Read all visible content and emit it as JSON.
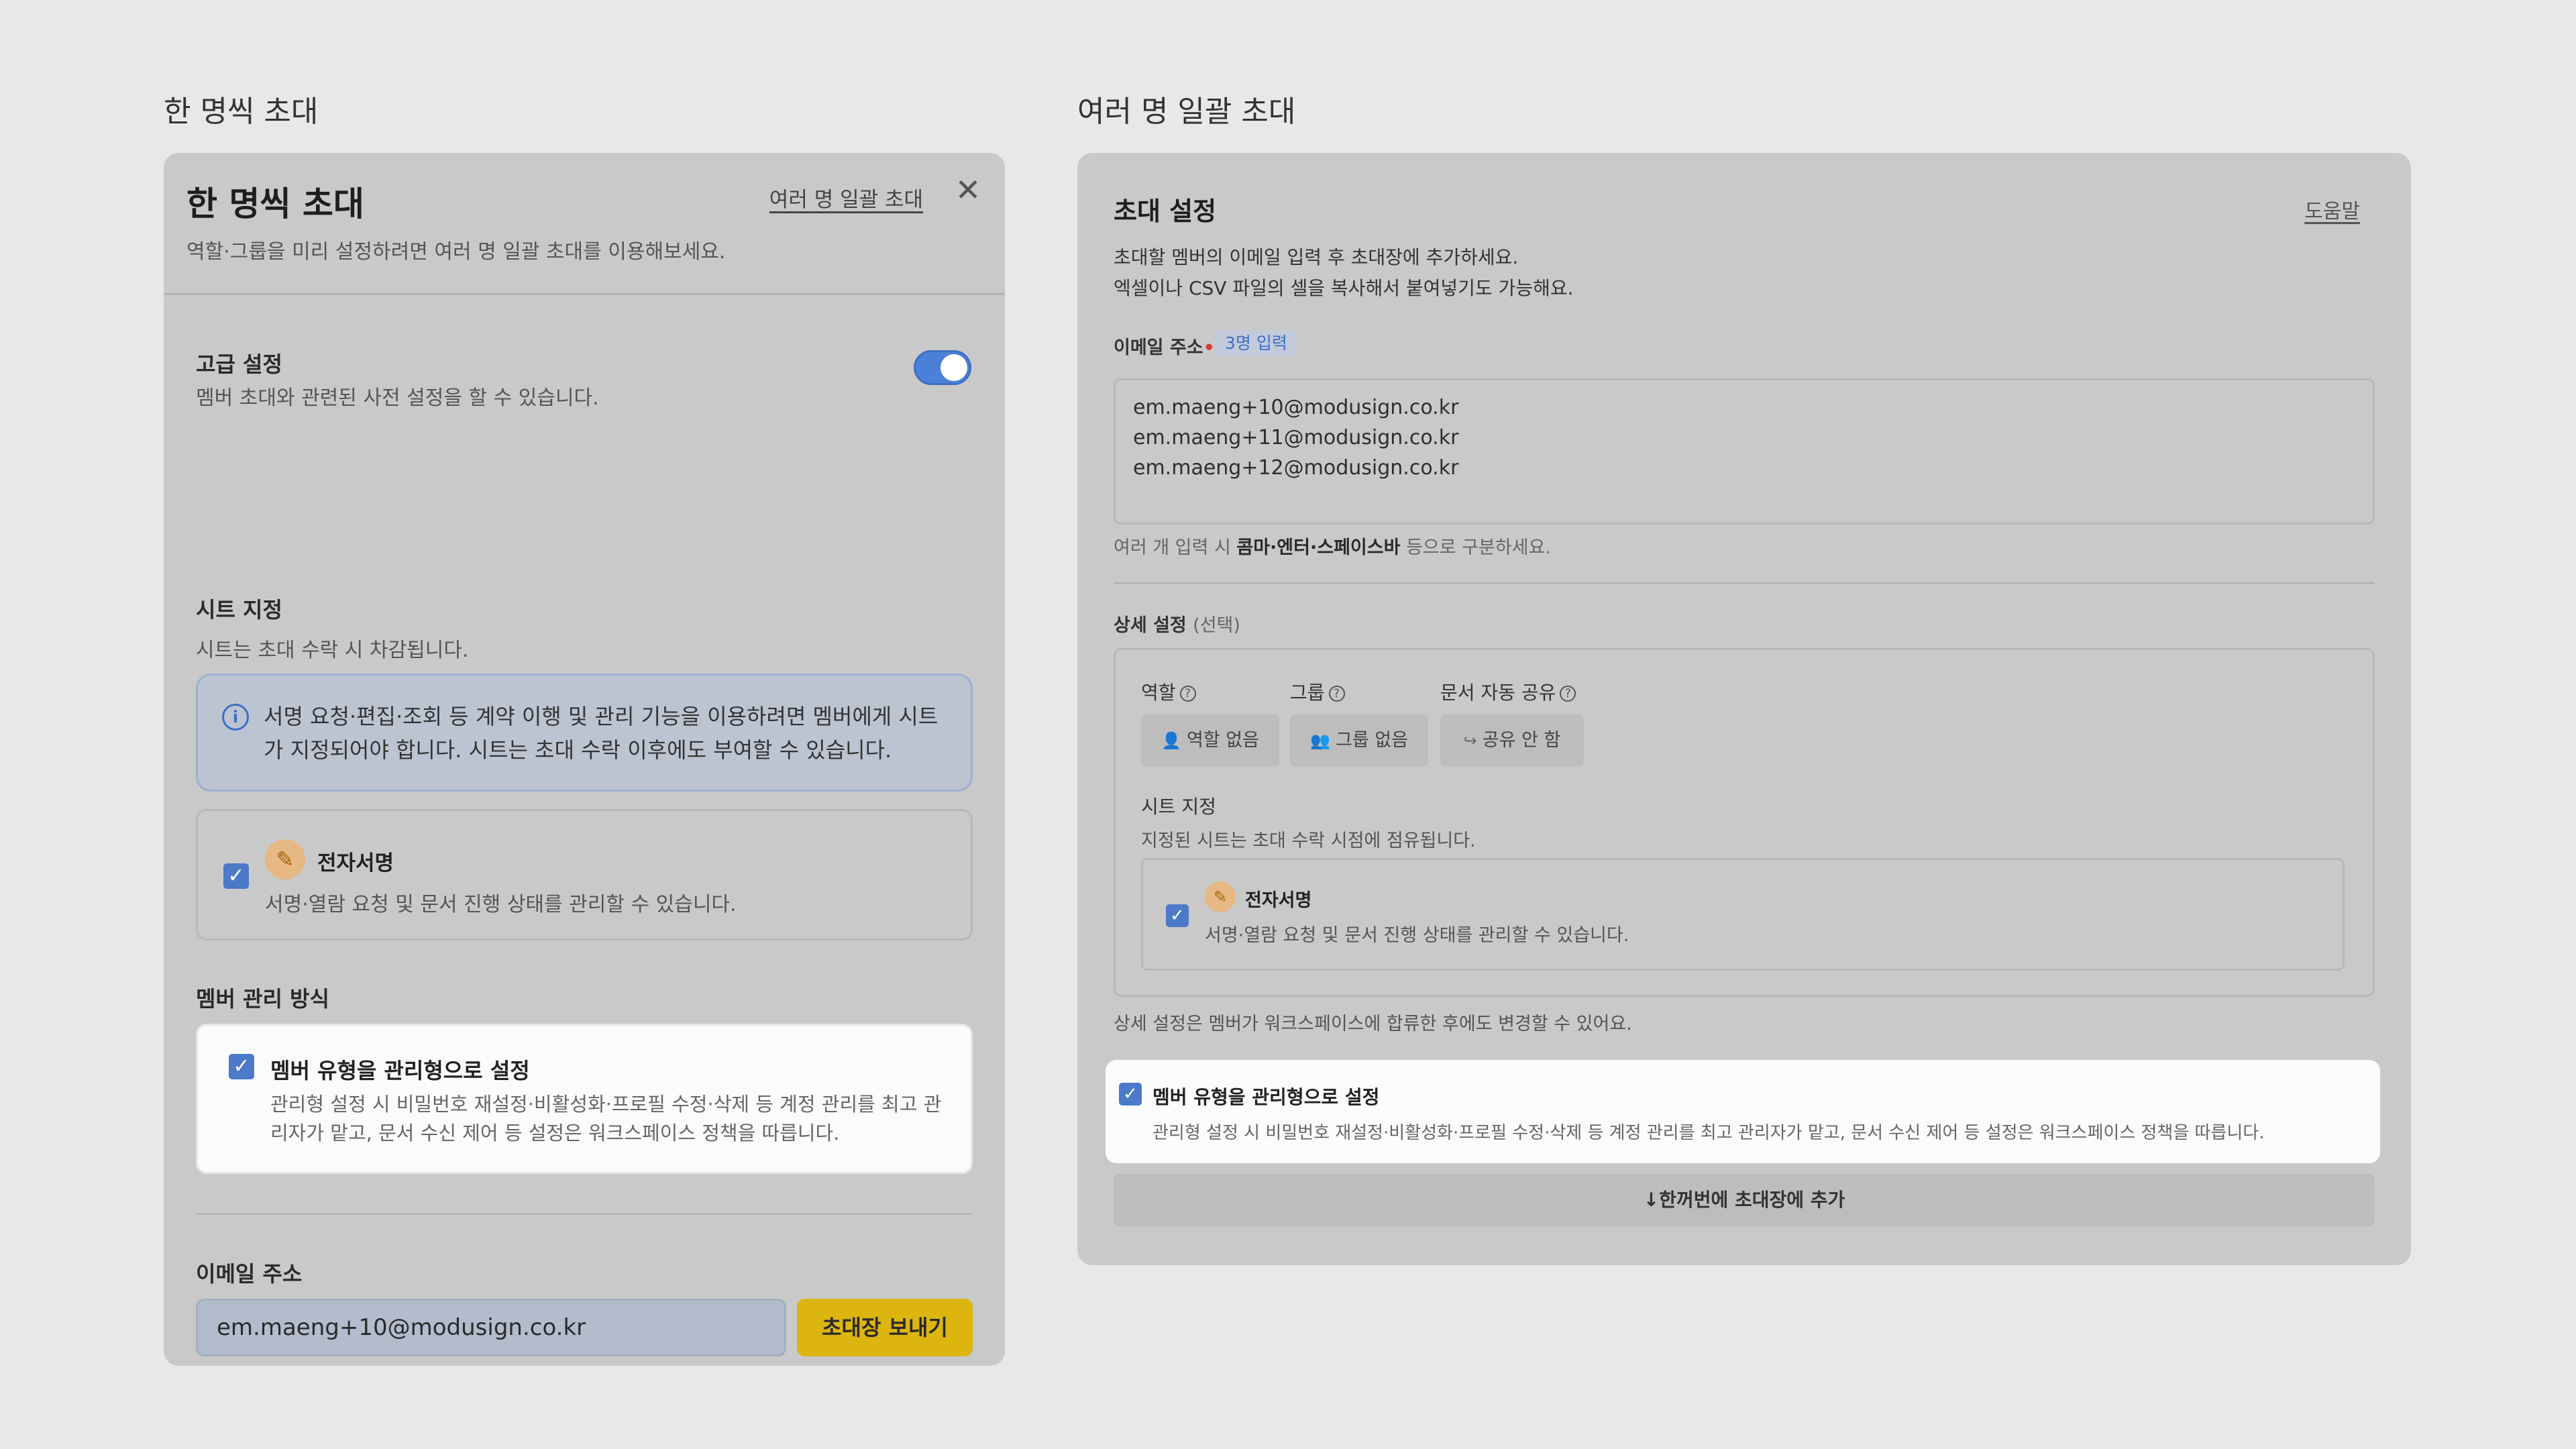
{
  "section_titles": {
    "left": "한 명씩 초대",
    "right": "여러 명 일괄 초대"
  },
  "left_panel": {
    "title": "한 명씩 초대",
    "subtitle": "역할·그룹을 미리 설정하려면 여러 명 일괄 초대를 이용해보세요.",
    "bulk_link": "여러 명 일괄 초대",
    "close_icon": "close-icon",
    "advanced": {
      "label": "고급 설정",
      "description": "멤버 초대와 관련된 사전 설정을 할 수 있습니다.",
      "enabled": true
    },
    "seat": {
      "label": "시트 지정",
      "description": "시트는 초대 수락 시 차감됩니다.",
      "info_icon": "info-icon",
      "info_text": "서명 요청·편집·조회 등 계약 이행 및 관리 기능을 이용하려면 멤버에게 시트가 지정되어야 합니다. 시트는 초대 수락 이후에도 부여할 수 있습니다.",
      "esign": {
        "checked": true,
        "icon": "pen-icon",
        "title": "전자서명",
        "description": "서명·열람 요청 및 문서 진행 상태를 관리할 수 있습니다."
      }
    },
    "member_management": {
      "label": "멤버 관리 방식",
      "checked": true,
      "title": "멤버 유형을 관리형으로 설정",
      "description": "관리형 설정 시 비밀번호 재설정·비활성화·프로필 수정·삭제 등 계정 관리를 최고 관리자가 맡고, 문서 수신 제어 등 설정은 워크스페이스 정책을 따릅니다."
    },
    "email": {
      "label": "이메일 주소",
      "value": "em.maeng+10@modusign.co.kr",
      "send_button": "초대장 보내기"
    },
    "close_button": "닫기"
  },
  "right_panel": {
    "title": "초대 설정",
    "help_link": "도움말",
    "description_line1": "초대할 멤버의 이메일 입력 후 초대장에 추가하세요.",
    "description_line2": "엑셀이나 CSV 파일의 셀을 복사해서 붙여넣기도 가능해요.",
    "email": {
      "label": "이메일 주소",
      "required_mark": "•",
      "count_badge": "3명 입력",
      "entries": [
        "em.maeng+10@modusign.co.kr",
        "em.maeng+11@modusign.co.kr",
        "em.maeng+12@modusign.co.kr"
      ],
      "hint_prefix": "여러 개 입력 시 ",
      "hint_bold": "콤마·엔터·스페이스바",
      "hint_suffix": " 등으로 구분하세요."
    },
    "details": {
      "label": "상세 설정",
      "optional": "(선택)",
      "options": [
        {
          "label": "역할",
          "value": "역할 없음",
          "icon": "user-icon"
        },
        {
          "label": "그룹",
          "value": "그룹 없음",
          "icon": "group-icon"
        },
        {
          "label": "문서 자동 공유",
          "value": "공유 안 함",
          "icon": "share-icon"
        }
      ],
      "help_icon": "question-icon",
      "seat_label": "시트 지정",
      "seat_description": "지정된 시트는 초대 수락 시점에 점유됩니다.",
      "esign": {
        "checked": true,
        "icon": "pen-icon",
        "title": "전자서명",
        "description": "서명·열람 요청 및 문서 진행 상태를 관리할 수 있습니다."
      }
    },
    "change_note": "상세 설정은 멤버가 워크스페이스에 합류한 후에도 변경할 수 있어요.",
    "member_management": {
      "checked": true,
      "title": "멤버 유형을 관리형으로 설정",
      "description": "관리형 설정 시 비밀번호 재설정·비활성화·프로필 수정·삭제 등 계정 관리를 최고 관리자가 맡고, 문서 수신 제어 등 설정은 워크스페이스 정책을 따릅니다."
    },
    "add_button": "↓한꺼번에 초대장에 추가"
  },
  "colors": {
    "background": "#e8e8e8",
    "panel": "#c9c9c9",
    "accent_blue": "#4d7ac8",
    "send_yellow": "#dcb50f",
    "required_red": "#d73b3b"
  }
}
